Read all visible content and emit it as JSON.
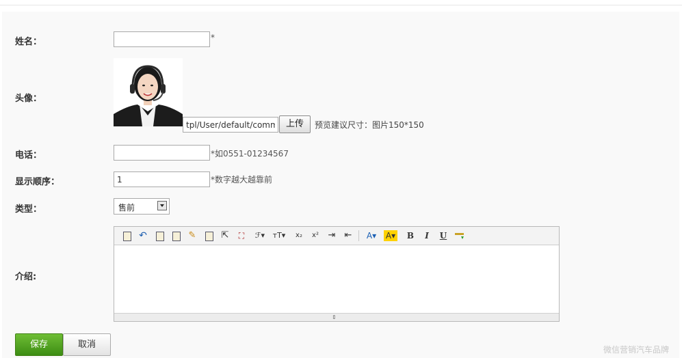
{
  "form": {
    "name_label": "姓名：",
    "name_value": "",
    "name_required": "*",
    "avatar_label": "头像：",
    "avatar_path": "tpl/User/default/common/images/portrait.jpg",
    "upload_button": "上传",
    "avatar_hint": "预览建议尺寸：图片150*150",
    "phone_label": "电话：",
    "phone_value": "",
    "phone_hint": "*如0551-01234567",
    "order_label": "显示顺序：",
    "order_value": "1",
    "order_hint": "*数字越大越靠前",
    "type_label": "类型：",
    "type_value": "售前",
    "intro_label": "介绍:",
    "save_button": "保存",
    "cancel_button": "取消"
  },
  "editor": {
    "toolbar": [
      "source-icon",
      "undo-icon",
      "paste-text-icon",
      "paste-word-icon",
      "clear-format-icon",
      "select-all-icon",
      "pointer-icon",
      "fullscreen-icon",
      "font-family-icon",
      "font-size-icon",
      "subscript-icon",
      "superscript-icon",
      "indent-icon",
      "outdent-icon",
      "font-color-icon",
      "highlight-color-icon",
      "bold-icon",
      "italic-icon",
      "underline-icon",
      "horizontal-rule-icon"
    ],
    "toolbar_glyphs": {
      "font_family": "ℱ▾",
      "font_size": "тT▾",
      "subscript": "x₂",
      "superscript": "x²",
      "font_color": "A▾",
      "highlight": "A▾",
      "bold": "B",
      "italic": "I",
      "underline": "U"
    },
    "resize_grip": "⇕"
  },
  "watermark": "微信营销汽车品牌",
  "colors": {
    "panel_bg": "#f9f9f9",
    "save_green": "#4f9e1f",
    "highlight_yellow": "#ffd200",
    "font_color_blue": "#1a5fb4"
  }
}
